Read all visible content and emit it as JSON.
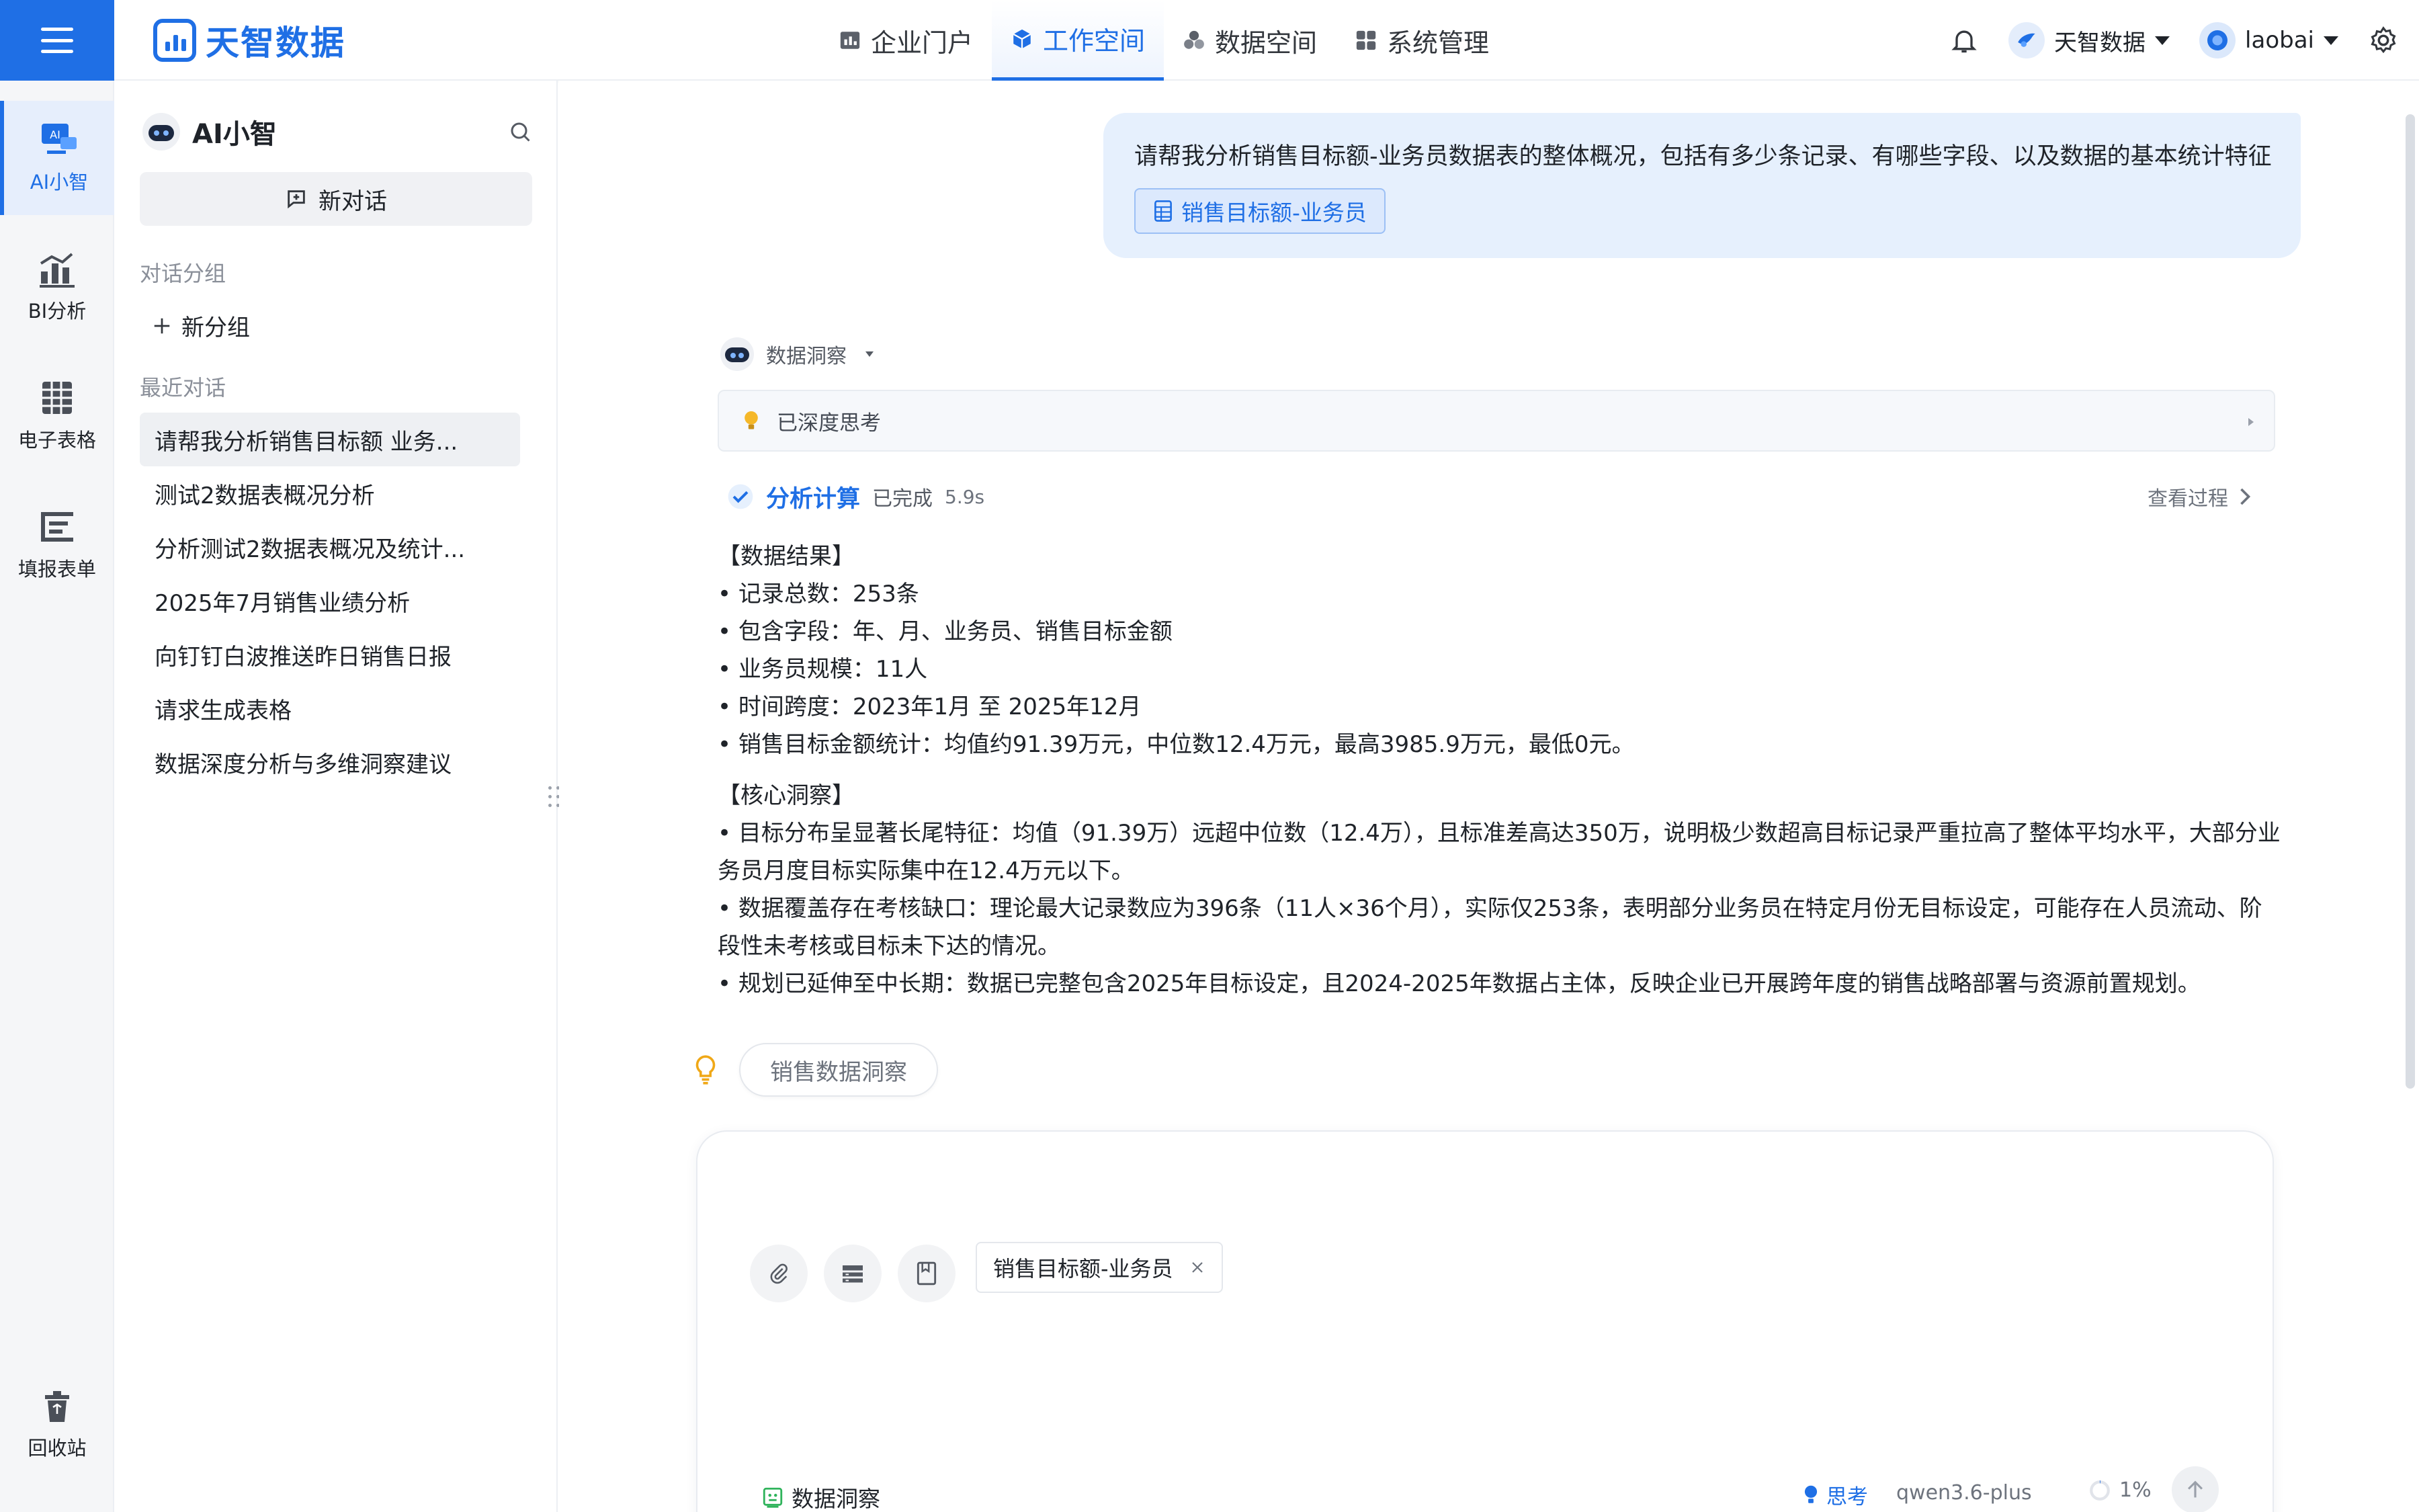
{
  "brand": {
    "name": "天智数据"
  },
  "topnav": [
    {
      "label": "企业门户",
      "icon": "dashboard-icon",
      "active": false
    },
    {
      "label": "工作空间",
      "icon": "cube-icon",
      "active": true
    },
    {
      "label": "数据空间",
      "icon": "cluster-icon",
      "active": false
    },
    {
      "label": "系统管理",
      "icon": "grid-icon",
      "active": false
    }
  ],
  "topright": {
    "org_name": "天智数据",
    "user_name": "laobai"
  },
  "rail": {
    "items": [
      {
        "label": "AI小智",
        "icon": "ai-monitor-icon",
        "active": true
      },
      {
        "label": "BI分析",
        "icon": "bar-chart-icon",
        "active": false
      },
      {
        "label": "电子表格",
        "icon": "spreadsheet-icon",
        "active": false
      },
      {
        "label": "填报表单",
        "icon": "form-icon",
        "active": false
      }
    ],
    "recycle_label": "回收站"
  },
  "conversations": {
    "title": "AI小智",
    "new_chat_label": "新对话",
    "groups_label": "对话分组",
    "new_group_label": "新分组",
    "recent_label": "最近对话",
    "items": [
      {
        "label": "请帮我分析销售目标额 业务...",
        "active": true
      },
      {
        "label": "测试2数据表概况分析",
        "active": false
      },
      {
        "label": "分析测试2数据表概况及统计...",
        "active": false
      },
      {
        "label": "2025年7月销售业绩分析",
        "active": false
      },
      {
        "label": "向钉钉白波推送昨日销售日报",
        "active": false
      },
      {
        "label": "请求生成表格",
        "active": false
      },
      {
        "label": "数据深度分析与多维洞察建议",
        "active": false
      }
    ]
  },
  "chat": {
    "user_message": "请帮我分析销售目标额-业务员数据表的整体概况，包括有多少条记录、有哪些字段、以及数据的基本统计特征",
    "user_attachment": "销售目标额-业务员",
    "bot_name": "数据洞察",
    "thinking_label": "已深度思考",
    "analysis": {
      "title": "分析计算",
      "status": "已完成",
      "duration": "5.9s",
      "view_label": "查看过程"
    },
    "result_heading": "【数据结果】",
    "result_items": [
      "• 记录总数：253条",
      "• 包含字段：年、月、业务员、销售目标金额",
      "• 业务员规模：11人",
      "• 时间跨度：2023年1月 至 2025年12月",
      "• 销售目标金额统计：均值约91.39万元，中位数12.4万元，最高3985.9万元，最低0元。"
    ],
    "insight_heading": "【核心洞察】",
    "insight_items": [
      "• 目标分布呈显著长尾特征：均值（91.39万）远超中位数（12.4万），且标准差高达350万，说明极少数超高目标记录严重拉高了整体平均水平，大部分业务员月度目标实际集中在12.4万元以下。",
      "• 数据覆盖存在考核缺口：理论最大记录数应为396条（11人×36个月），实际仅253条，表明部分业务员在特定月份无目标设定，可能存在人员流动、阶段性未考核或目标未下达的情况。",
      "• 规划已延伸至中长期：数据已完整包含2025年目标设定，且2024-2025年数据占主体，反映企业已开展跨年度的销售战略部署与资源前置规划。"
    ],
    "suggestion": "销售数据洞察"
  },
  "composer": {
    "attachment": "销售目标额-业务员",
    "mode_label": "数据洞察",
    "think_label": "思考",
    "model": "qwen3.6-plus",
    "context_usage": "1%"
  },
  "colors": {
    "accent": "#1f6fe5",
    "bubble": "#e6f0fd",
    "rail_bg": "#f5f6f8"
  }
}
